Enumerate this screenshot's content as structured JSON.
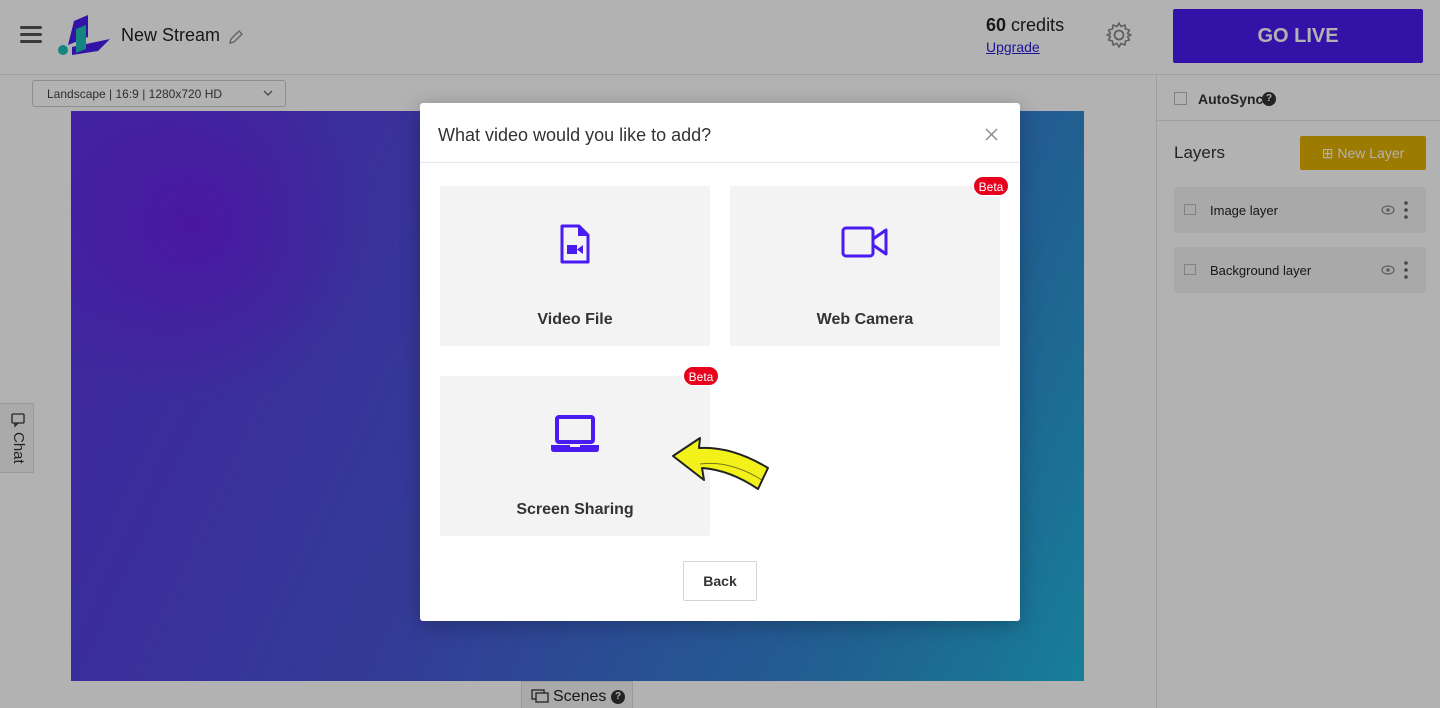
{
  "header": {
    "stream_title": "New Stream",
    "credits_amount": "60",
    "credits_label": "credits",
    "upgrade_link": "Upgrade",
    "go_live_label": "GO LIVE"
  },
  "toolbar": {
    "resolution": "Landscape | 16:9 | 1280x720 HD"
  },
  "side_tabs": {
    "chat_label": "Chat",
    "scenes_label": "Scenes",
    "scenes_help": "?"
  },
  "right_panel": {
    "autosync_label": "AutoSync",
    "autosync_help": "?",
    "layers_title": "Layers",
    "new_layer_label": "New Layer",
    "layers": [
      {
        "name": "Image layer"
      },
      {
        "name": "Background layer"
      }
    ]
  },
  "modal": {
    "title": "What video would you like to add?",
    "options": [
      {
        "label": "Video File",
        "icon": "video-file-icon",
        "badge": ""
      },
      {
        "label": "Web Camera",
        "icon": "video-camera-icon",
        "badge": "Beta"
      },
      {
        "label": "Screen Sharing",
        "icon": "laptop-icon",
        "badge": "Beta"
      }
    ],
    "back_label": "Back"
  },
  "colors": {
    "accent": "#4a1bf0",
    "icon_purple": "#4a1bf0",
    "new_layer_yellow": "#e0b000",
    "beta_red": "#e8001c",
    "arrow_yellow": "#f2f21a"
  }
}
